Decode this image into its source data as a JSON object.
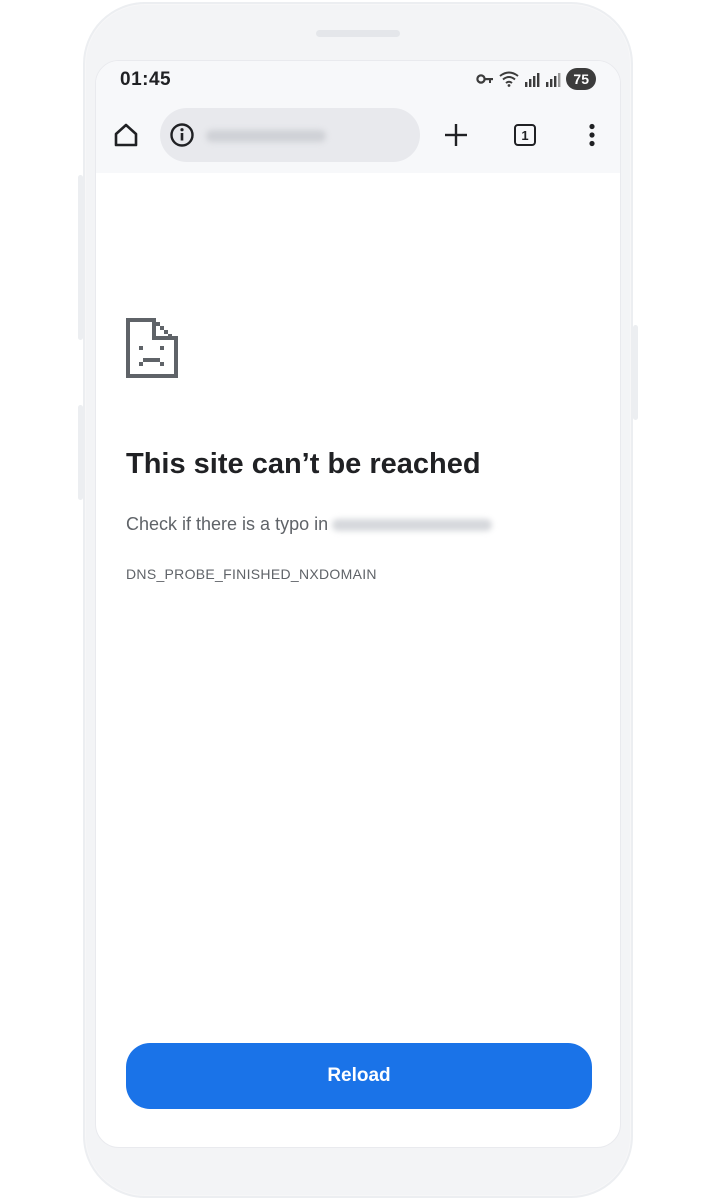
{
  "status_bar": {
    "time": "01:45",
    "battery": "75",
    "icons": [
      "vpn-key-icon",
      "wifi-icon",
      "signal-icon",
      "signal-icon"
    ]
  },
  "toolbar": {
    "home_icon": "home-icon",
    "info_icon": "info-icon",
    "new_tab_icon": "plus-icon",
    "tab_count": "1",
    "menu_icon": "more-vert-icon"
  },
  "error_page": {
    "icon": "sad-document-icon",
    "title": "This site can’t be reached",
    "description": "Check if there is a typo in",
    "error_code": "DNS_PROBE_FINISHED_NXDOMAIN",
    "reload_label": "Reload"
  },
  "colors": {
    "accent": "#1a73e8",
    "text_primary": "#202124",
    "text_secondary": "#5f6368"
  }
}
